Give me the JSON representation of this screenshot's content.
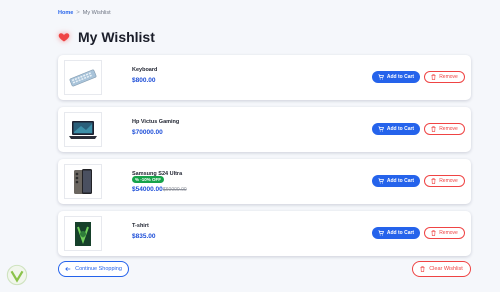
{
  "breadcrumb": {
    "home": "Home",
    "separator": ">",
    "current": "My Wishlist"
  },
  "page": {
    "title": "My Wishlist"
  },
  "items": [
    {
      "name": "Keyboard",
      "price": "$800.00",
      "icon": "keyboard-image"
    },
    {
      "name": "Hp Victus Gaming",
      "price": "$70000.00",
      "icon": "laptop-image"
    },
    {
      "name": "Samsung S24 Ultra",
      "badge": "% -10% OFF",
      "price": "$54000.00",
      "old_price": "$60000.00",
      "icon": "phone-image"
    },
    {
      "name": "T-shirt",
      "price": "$835.00",
      "icon": "tshirt-image"
    }
  ],
  "actions": {
    "add_to_cart": "Add to Cart",
    "remove": "Remove",
    "continue_shopping": "Continue Shopping",
    "clear_wishlist": "Clear Wishlist"
  },
  "colors": {
    "primary": "#2563eb",
    "danger": "#ef4444",
    "price": "#1d4ed8",
    "discount_badge": "#16a34a",
    "background": "#f5f7fb"
  }
}
